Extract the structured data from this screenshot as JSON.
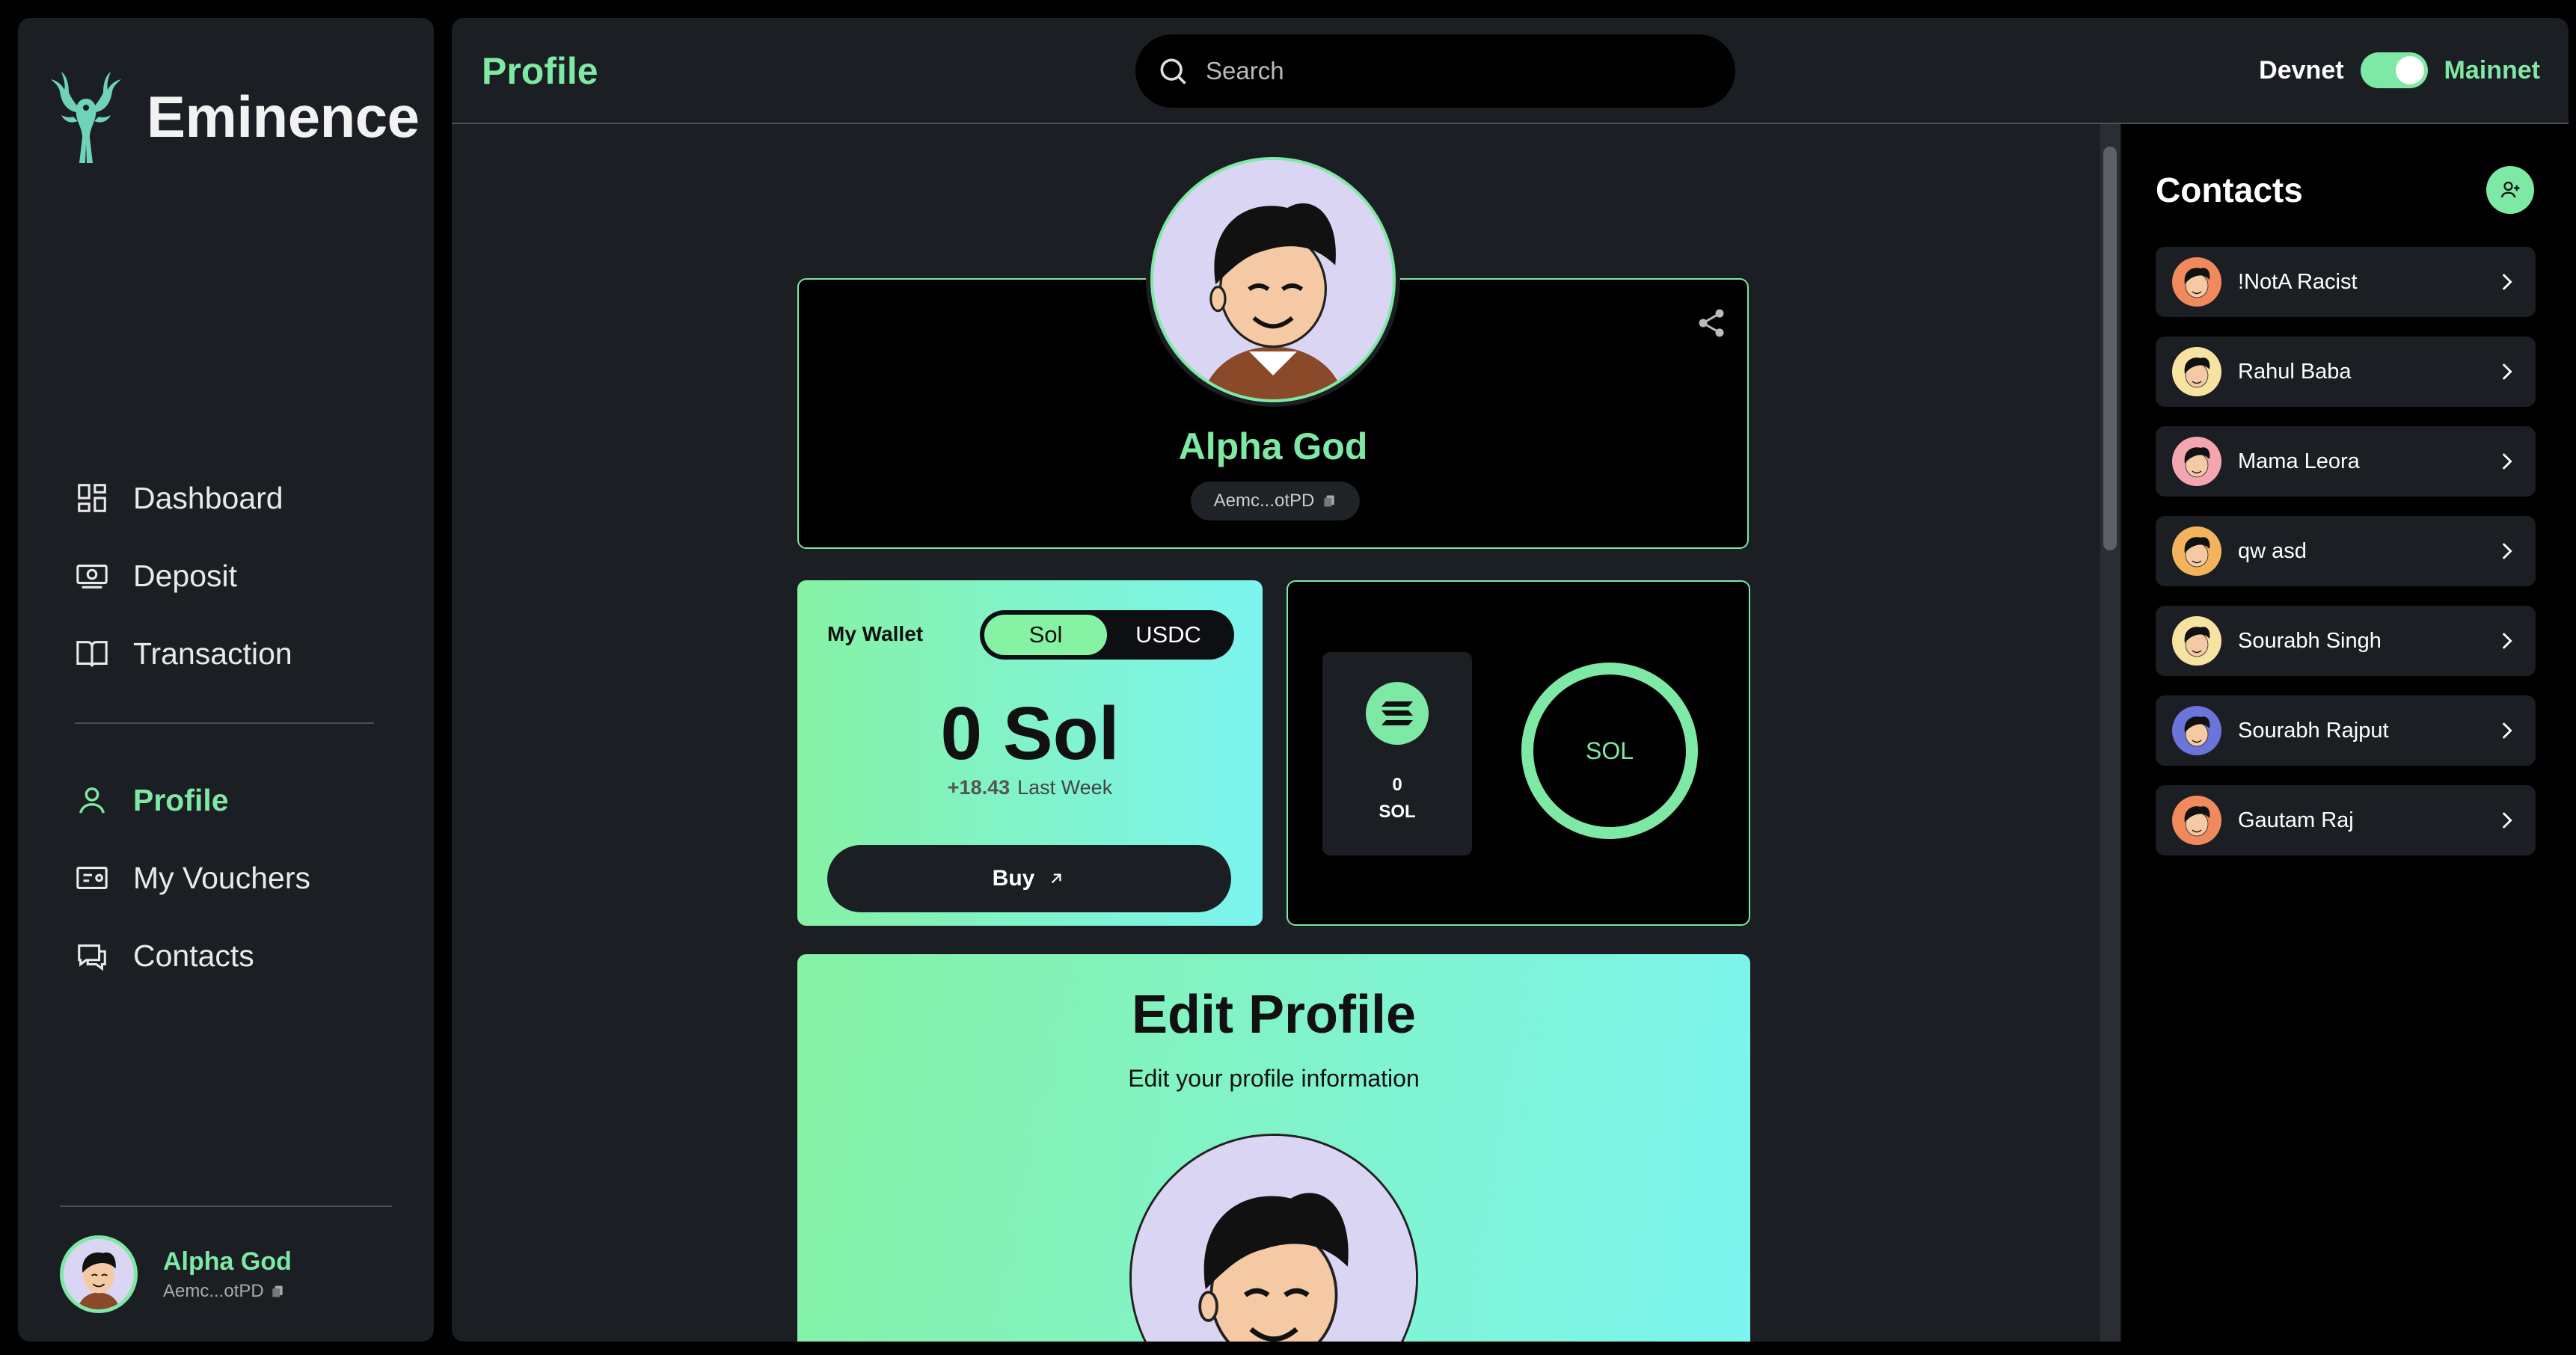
{
  "brand": {
    "name": "Eminence"
  },
  "nav": {
    "items": [
      {
        "label": "Dashboard",
        "icon": "dashboard-icon"
      },
      {
        "label": "Deposit",
        "icon": "deposit-icon"
      },
      {
        "label": "Transaction",
        "icon": "book-icon"
      }
    ],
    "items2": [
      {
        "label": "Profile",
        "icon": "user-icon",
        "active": true
      },
      {
        "label": "My Vouchers",
        "icon": "voucher-icon"
      },
      {
        "label": "Contacts",
        "icon": "chat-icon"
      }
    ]
  },
  "user": {
    "name": "Alpha God",
    "address": "Aemc...otPD"
  },
  "header": {
    "title": "Profile",
    "search_placeholder": "Search",
    "network_left": "Devnet",
    "network_right": "Mainnet",
    "network_selected": "Mainnet"
  },
  "profile": {
    "name": "Alpha God",
    "address": "Aemc...otPD"
  },
  "wallet": {
    "label": "My Wallet",
    "tabs": [
      "Sol",
      "USDC"
    ],
    "selected_tab": "Sol",
    "balance": "0 Sol",
    "delta_value": "+18.43",
    "delta_label": "Last Week",
    "buy_label": "Buy"
  },
  "token": {
    "amount": "0",
    "symbol": "SOL",
    "ring_label": "SOL"
  },
  "edit": {
    "title": "Edit Profile",
    "subtitle": "Edit your profile information"
  },
  "contacts": {
    "title": "Contacts",
    "items": [
      {
        "name": "!NotA Racist"
      },
      {
        "name": "Rahul Baba"
      },
      {
        "name": "Mama Leora"
      },
      {
        "name": "qw asd"
      },
      {
        "name": "Sourabh Singh"
      },
      {
        "name": "Sourabh Rajput"
      },
      {
        "name": "Gautam Raj"
      }
    ]
  },
  "colors": {
    "accent": "#7ee8a5",
    "panel": "#1b1e22",
    "gradient_start": "#86f2a4",
    "gradient_end": "#7cf4f0"
  }
}
